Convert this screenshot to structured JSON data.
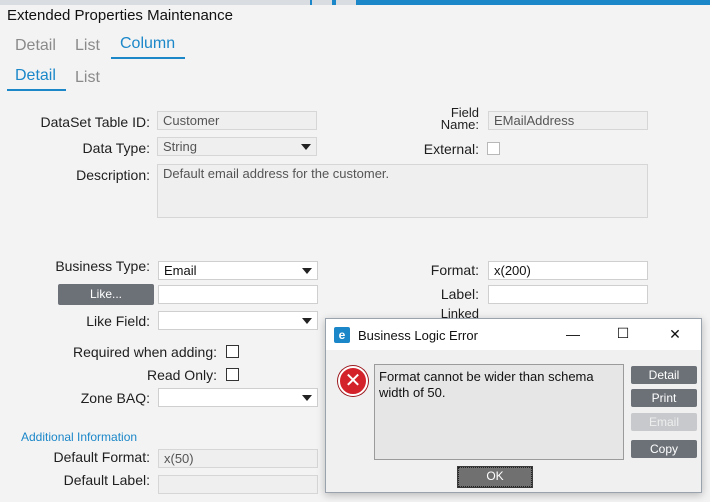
{
  "app": {
    "title": "Extended Properties Maintenance"
  },
  "tabs_top": [
    "Detail",
    "List",
    "Column"
  ],
  "tabs_sub": [
    "Detail",
    "List"
  ],
  "form": {
    "dataset_table_label": "DataSet Table ID:",
    "dataset_table_value": "Customer",
    "field_name_label_1": "Field",
    "field_name_label_2": "Name:",
    "field_name_value": "EMailAddress",
    "data_type_label": "Data Type:",
    "data_type_value": "String",
    "external_label": "External:",
    "description_label": "Description:",
    "description_value": "Default email address for the customer.",
    "business_type_label": "Business Type:",
    "business_type_value": "Email",
    "format_label": "Format:",
    "format_value": "x(200)",
    "like_button": "Like...",
    "label_label": "Label:",
    "linked_label": "Linked",
    "like_field_label": "Like Field:",
    "required_label": "Required when adding:",
    "readonly_label": "Read Only:",
    "zone_baq_label": "Zone BAQ:",
    "additional_info": "Additional Information",
    "default_format_label": "Default Format:",
    "default_format_value": "x(50)",
    "default_label_label": "Default Label:"
  },
  "dialog": {
    "logo": "e",
    "title": "Business Logic Error",
    "minimize": "—",
    "maximize": "☐",
    "close": "✕",
    "icon_glyph": "✕",
    "message": "Format cannot be wider than schema width of 50.",
    "buttons": {
      "detail": "Detail",
      "print": "Print",
      "email": "Email",
      "copy": "Copy",
      "ok": "OK"
    }
  }
}
